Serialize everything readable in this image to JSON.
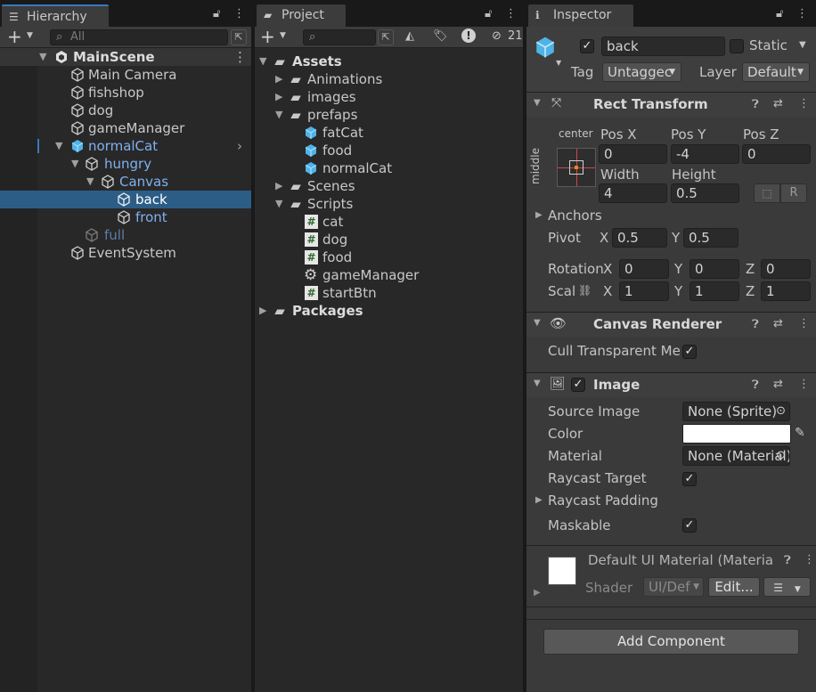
{
  "hierarchy": {
    "tab": "Hierarchy",
    "search_placeholder": "All",
    "scene": "MainScene",
    "items": [
      {
        "label": "Main Camera"
      },
      {
        "label": "fishshop"
      },
      {
        "label": "dog"
      },
      {
        "label": "gameManager"
      },
      {
        "label": "normalCat"
      },
      {
        "label": "hungry"
      },
      {
        "label": "Canvas"
      },
      {
        "label": "back"
      },
      {
        "label": "front"
      },
      {
        "label": "full"
      },
      {
        "label": "EventSystem"
      }
    ]
  },
  "project": {
    "tab": "Project",
    "hidden_count": "21",
    "assets": "Assets",
    "items": [
      {
        "label": "Animations"
      },
      {
        "label": "images"
      },
      {
        "label": "prefaps"
      },
      {
        "label": "fatCat"
      },
      {
        "label": "food"
      },
      {
        "label": "normalCat"
      },
      {
        "label": "Scenes"
      },
      {
        "label": "Scripts"
      },
      {
        "label": "cat"
      },
      {
        "label": "dog"
      },
      {
        "label": "food"
      },
      {
        "label": "gameManager"
      },
      {
        "label": "startBtn"
      }
    ],
    "packages": "Packages"
  },
  "inspector": {
    "tab": "Inspector",
    "object_name": "back",
    "static_label": "Static",
    "tag_label": "Tag",
    "tag_value": "Untaggec",
    "layer_label": "Layer",
    "layer_value": "Default",
    "rect": {
      "title": "Rect Transform",
      "anchor_h": "center",
      "anchor_v": "middle",
      "posx_label": "Pos X",
      "posx": "0",
      "posy_label": "Pos Y",
      "posy": "-4",
      "posz_label": "Pos Z",
      "posz": "0",
      "width_label": "Width",
      "width": "4",
      "height_label": "Height",
      "height": "0.5",
      "anchors_label": "Anchors",
      "pivot_label": "Pivot",
      "pivot_x": "0.5",
      "pivot_y": "0.5",
      "rotation_label": "Rotation",
      "rot_x": "0",
      "rot_y": "0",
      "rot_z": "0",
      "scale_label": "Scal",
      "scale_x": "1",
      "scale_y": "1",
      "scale_z": "1",
      "x": "X",
      "y": "Y",
      "z": "Z",
      "r_btn": "R"
    },
    "canvas_renderer": {
      "title": "Canvas Renderer",
      "cull_label": "Cull Transparent Mes"
    },
    "image": {
      "title": "Image",
      "source_label": "Source Image",
      "source_value": "None (Sprite)",
      "color_label": "Color",
      "color_value": "#ffffff",
      "material_label": "Material",
      "material_value": "None (Material)",
      "raycast_target_label": "Raycast Target",
      "raycast_padding_label": "Raycast Padding",
      "maskable_label": "Maskable"
    },
    "material": {
      "title": "Default UI Material (Materia",
      "shader_label": "Shader",
      "shader_value": "UI/Def",
      "edit_label": "Edit..."
    },
    "add_component": "Add Component"
  },
  "colors": {
    "accent": "#7fb1f0",
    "selection": "#2c5d87",
    "prefab_blue": "#4fb3e8"
  }
}
